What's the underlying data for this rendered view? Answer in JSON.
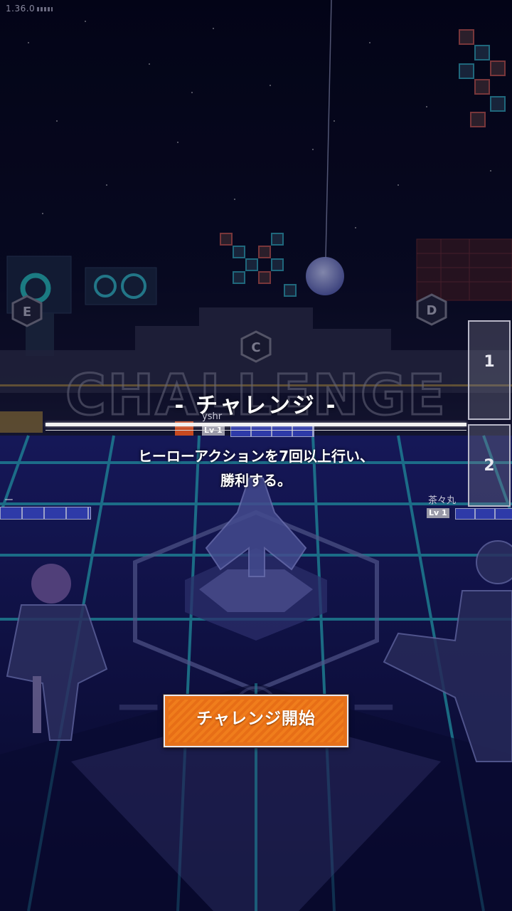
{
  "version": "1.36.0",
  "challenge": {
    "title": "- チャレンジ -",
    "description_line1": "ヒーローアクションを7回以上行い、",
    "description_line2": "勝利する。",
    "start_button": "チャレンジ開始"
  },
  "players": {
    "top_name": "yshr",
    "top_level": "Lv 1",
    "right_name": "茶々丸",
    "right_level": "Lv 1",
    "left_name_partial": "ー"
  },
  "ranks": [
    "1",
    "2"
  ],
  "background_banner": "CHALLENGE",
  "zones": [
    "E",
    "C",
    "D"
  ],
  "colors": {
    "button_orange": "#e6711b",
    "grid_cyan": "#2fbcd0",
    "sky": "#06071a"
  }
}
